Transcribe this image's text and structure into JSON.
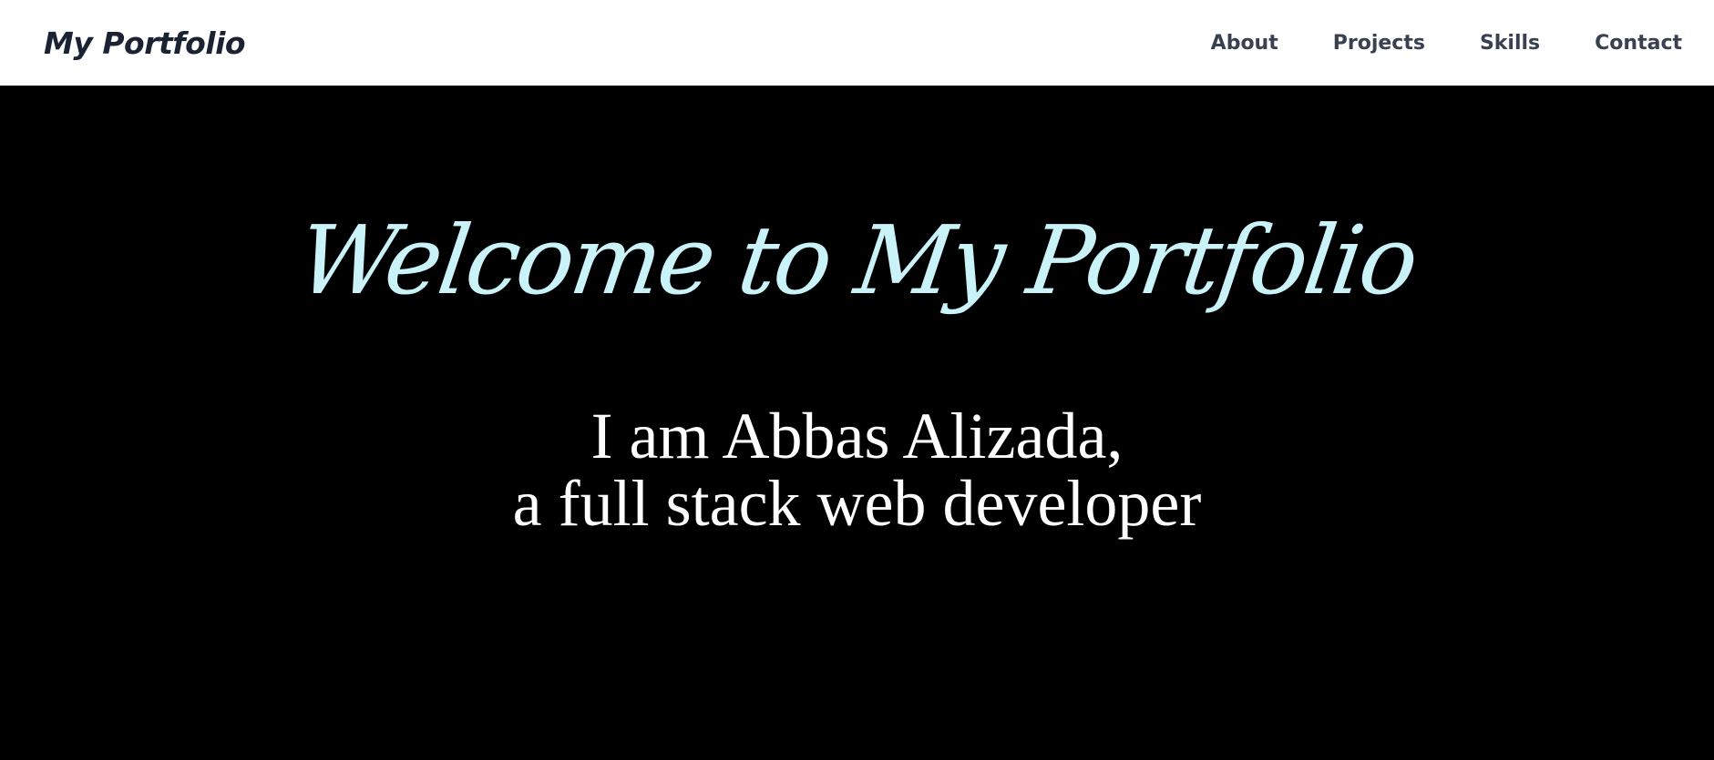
{
  "header": {
    "brand": "My Portfolio",
    "nav": [
      {
        "label": "About"
      },
      {
        "label": "Projects"
      },
      {
        "label": "Skills"
      },
      {
        "label": "Contact"
      }
    ]
  },
  "hero": {
    "title": "Welcome to My Portfolio",
    "subtitle_line1": "I am Abbas Alizada,",
    "subtitle_line2": "a full stack web developer"
  },
  "colors": {
    "header_background": "#ffffff",
    "brand_text": "#1a2233",
    "nav_text": "#374151",
    "hero_background": "#000000",
    "hero_title": "#c9f3f8",
    "hero_subtitle": "#ffffff"
  }
}
